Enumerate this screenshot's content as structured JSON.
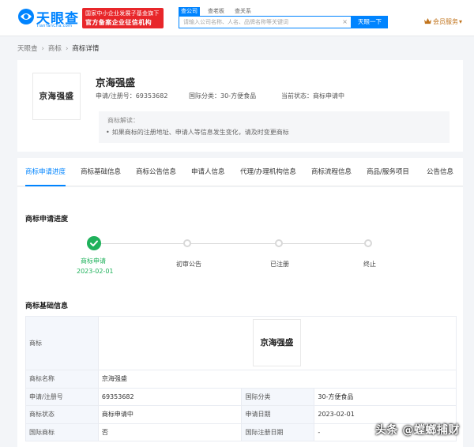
{
  "header": {
    "logo_text": "天眼查",
    "logo_sub": "TianYanCha.com",
    "banner_line1": "国家中小企业发展子基金旗下",
    "banner_line2": "官方备案企业征信机构",
    "search_tabs": [
      "查公司",
      "查老板",
      "查关系"
    ],
    "search_placeholder": "请输入公司名称、人名、品牌名称等关键词",
    "search_button": "天眼一下",
    "vip_label": "会员服务",
    "vip_caret": "▾",
    "brand_color": "#0084ff"
  },
  "breadcrumb": [
    "天眼查",
    "商标",
    "商标详情"
  ],
  "trademark": {
    "image_text": "京海强盛",
    "name": "京海强盛",
    "reg_no_label": "申请/注册号：",
    "reg_no": "69353682",
    "class_label": "国际分类：",
    "class_value": "30-方便食品",
    "status_label": "当前状态：",
    "status_value": "商标申请中"
  },
  "interpretation": {
    "title": "商标解读：",
    "bullet": "•",
    "line": "如果商标的注册地址、申请人等信息发生变化，请及时变更商标"
  },
  "tabs": [
    "商标申请进度",
    "商标基础信息",
    "商标公告信息",
    "申请人信息",
    "代理/办理机构信息",
    "商标流程信息",
    "商品/服务项目",
    "公告信息"
  ],
  "progress": {
    "title": "商标申请进度",
    "steps": [
      {
        "label": "商标申请",
        "date": "2023-02-01",
        "done": true
      },
      {
        "label": "初审公告",
        "date": "",
        "done": false
      },
      {
        "label": "已注册",
        "date": "",
        "done": false
      },
      {
        "label": "终止",
        "date": "",
        "done": false
      }
    ],
    "done_color": "#1fb15b"
  },
  "basic_info": {
    "title": "商标基础信息",
    "rows": {
      "logo_key": "商标",
      "logo_text": "京海强盛",
      "name_key": "商标名称",
      "name_val": "京海强盛",
      "regno_key": "申请/注册号",
      "regno_val": "69353682",
      "class_key": "国际分类",
      "class_val": "30-方便食品",
      "status_key": "商标状态",
      "status_val": "商标申请中",
      "date_key": "申请日期",
      "date_val": "2023-02-01",
      "intl_key": "国际商标",
      "intl_val": "否",
      "intl_date_key": "国际注册日期",
      "intl_date_val": "-"
    }
  },
  "watermark": "头条 @螳螂捕财"
}
